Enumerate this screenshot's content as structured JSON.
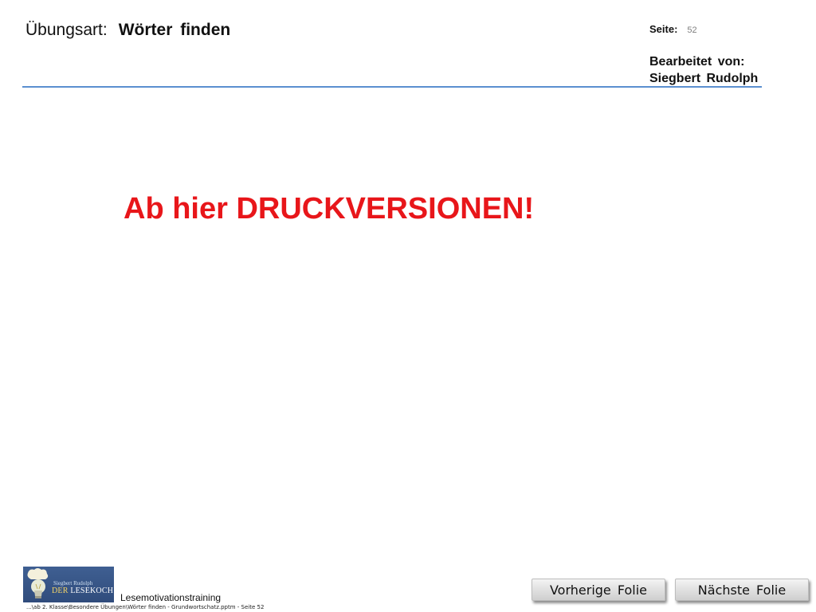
{
  "header": {
    "exercise_label": "Übungsart:",
    "exercise_value": "Wörter  finden",
    "page_label": "Seite:",
    "page_number": "52",
    "author_label": "Bearbeitet  von:",
    "author_name": "Siegbert  Rudolph"
  },
  "main": {
    "heading": "Ab hier DRUCKVERSIONEN!"
  },
  "footer": {
    "logo": {
      "name_text": "Siegbert Rudolph",
      "title_prefix": "DER",
      "title_main": "LESEKOCH"
    },
    "brand_text": "Lesemotivationstraining",
    "file_path": "...\\ab 2. Klasse\\Besondere Übungen\\Wörter finden - Grundwortschatz.pptm - Seite 52"
  },
  "nav": {
    "prev_label": "Vorherige  Folie",
    "next_label": "Nächste  Folie"
  },
  "colors": {
    "heading": "#e8161a",
    "rule": "#5b8fd0",
    "logo_bg": "#3f5f92"
  }
}
